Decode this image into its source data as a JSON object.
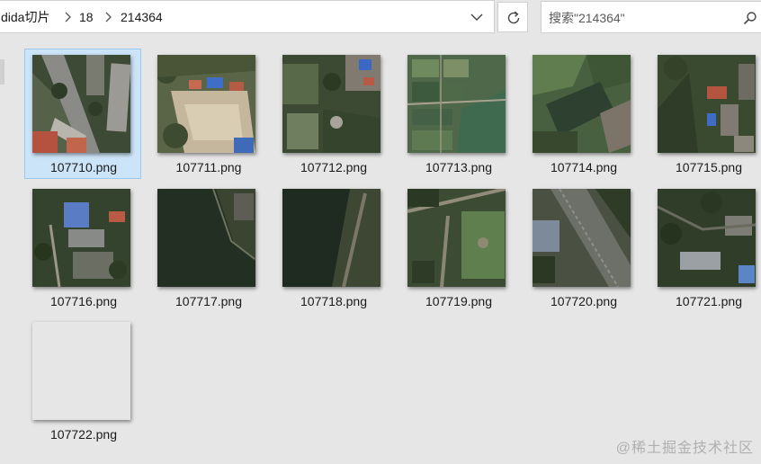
{
  "addressbar": {
    "breadcrumbs": [
      "dida切片",
      "18",
      "214364"
    ]
  },
  "search": {
    "placeholder": "搜索\"214364\""
  },
  "files": [
    {
      "name": "107710.png",
      "selected": true
    },
    {
      "name": "107711.png"
    },
    {
      "name": "107712.png"
    },
    {
      "name": "107713.png"
    },
    {
      "name": "107714.png"
    },
    {
      "name": "107715.png"
    },
    {
      "name": "107716.png"
    },
    {
      "name": "107717.png"
    },
    {
      "name": "107718.png"
    },
    {
      "name": "107719.png"
    },
    {
      "name": "107720.png"
    },
    {
      "name": "107721.png"
    },
    {
      "name": "107722.png"
    }
  ],
  "watermark": "@稀土掘金技术社区"
}
